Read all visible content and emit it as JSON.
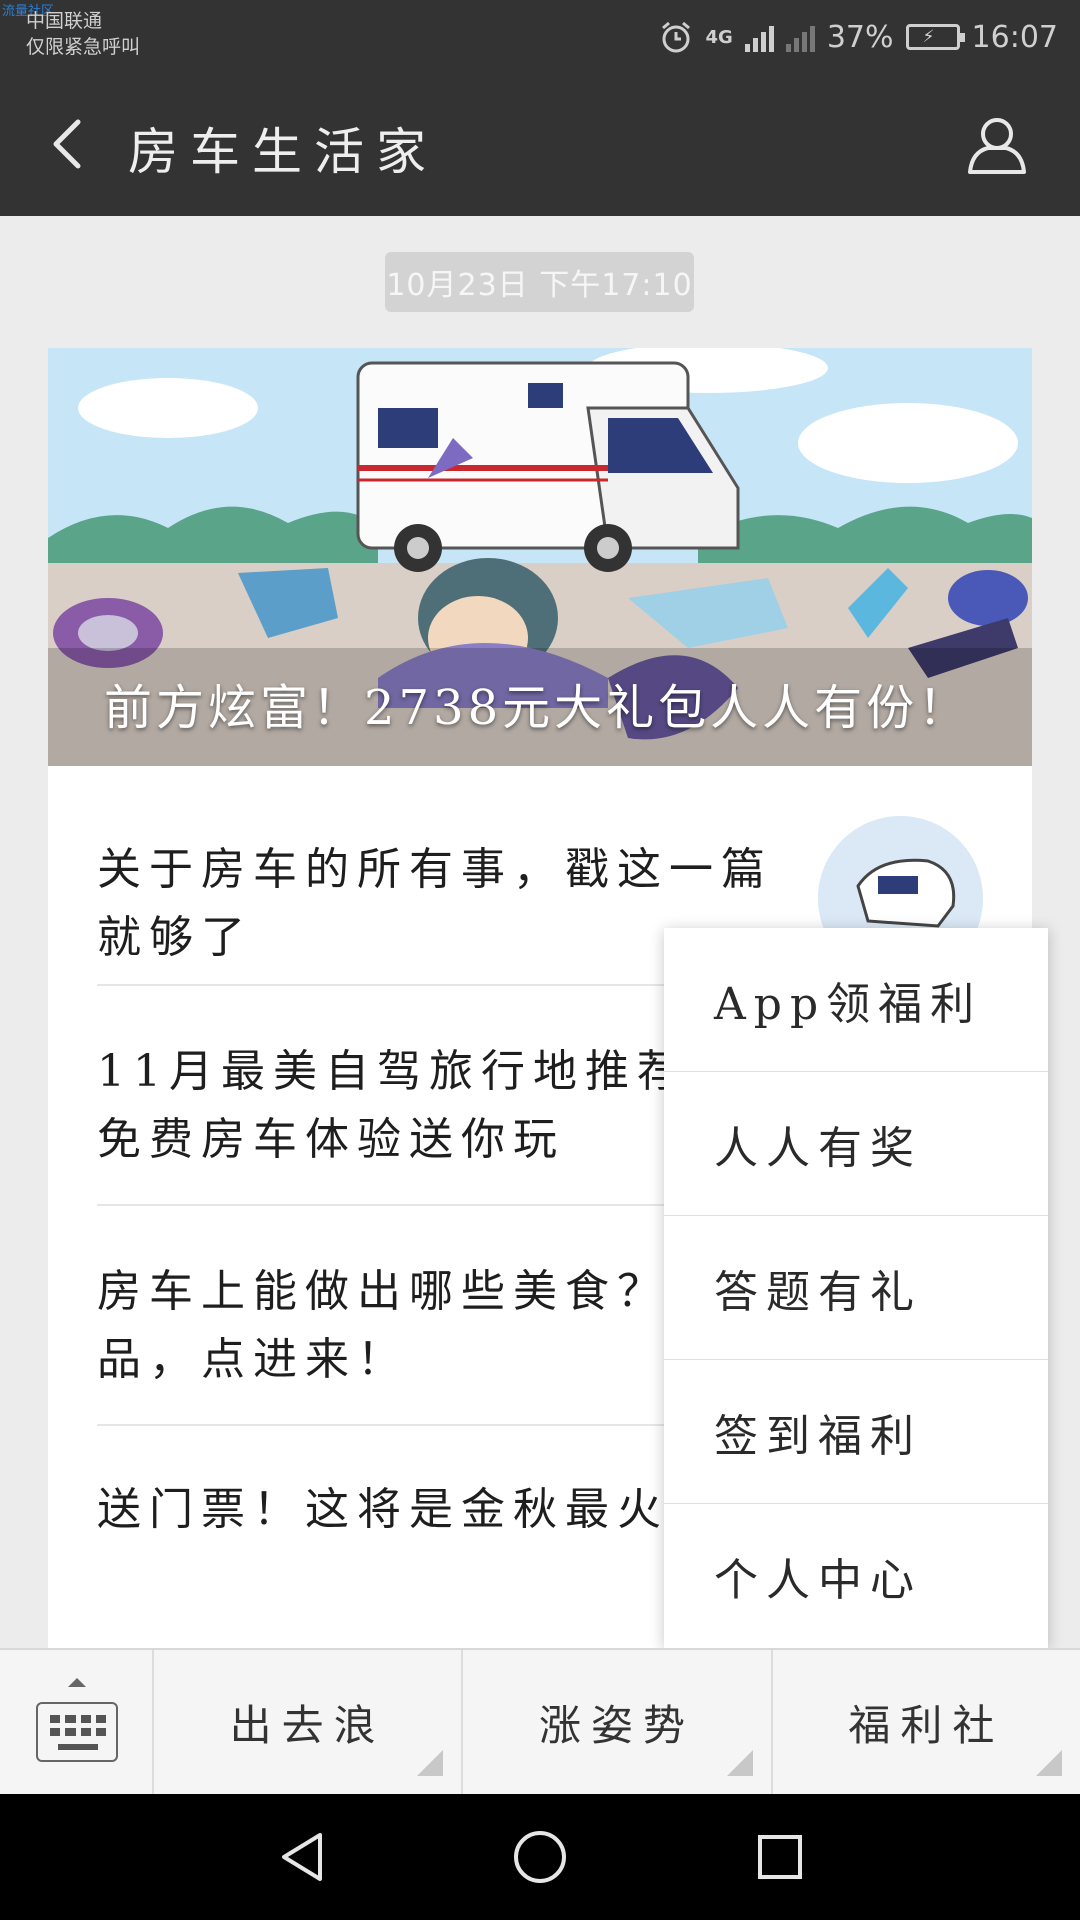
{
  "status_bar": {
    "watermark": "流量社区",
    "carrier_line1": "中国联通",
    "carrier_line2": "仅限紧急呼叫",
    "network": "4G",
    "battery": "37%",
    "time": "16:07"
  },
  "header": {
    "title": "房车生活家"
  },
  "timestamp": "10月23日 下午17:10",
  "banner": {
    "title": "前方炫富！2738元大礼包人人有份！"
  },
  "articles": [
    {
      "title": "关于房车的所有事，戳这一篇就够了"
    },
    {
      "title": "11月最美自驾旅行地推荐！2500元免费房车体验送你玩"
    },
    {
      "title": "房车上能做出哪些美食？你推荐我送奖品，点进来！"
    },
    {
      "title": "送门票！这将是金秋最火的音乐节！"
    }
  ],
  "popup_menu": {
    "items": [
      "App领福利",
      "人人有奖",
      "答题有礼",
      "签到福利",
      "个人中心"
    ]
  },
  "bottom_menu": {
    "tabs": [
      "出去浪",
      "涨姿势",
      "福利社"
    ]
  },
  "colors": {
    "header_bg": "#333333",
    "page_bg": "#ececec",
    "chip_bg": "#d3d3d3",
    "nav_bg": "#000000"
  }
}
